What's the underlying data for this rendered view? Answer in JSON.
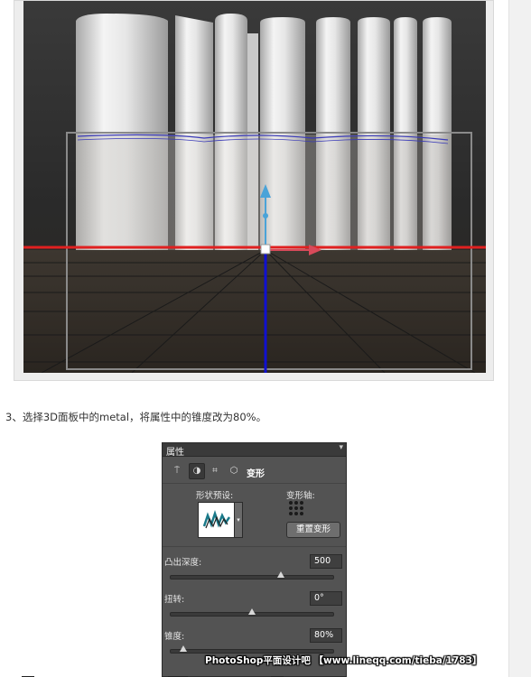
{
  "caption": {
    "text": "3、选择3D面板中的metal，将属性中的锥度改为80%。"
  },
  "panel": {
    "title": "属性",
    "menu_icon": "panel-menu-icon",
    "tools": [
      "mesh-icon",
      "deform-icon",
      "cap-icon",
      "coordinates-icon"
    ],
    "tab_label": "变形",
    "shape_preset_label": "形状预设:",
    "deform_axis_label": "变形轴:",
    "reset_button": "重置变形",
    "extrusion_depth_label": "凸出深度:",
    "extrusion_depth_value": "500",
    "twist_label": "扭转:",
    "twist_value": "0°",
    "taper_label": "锥度:",
    "taper_value": "80%",
    "extrusion_slider_fraction": 0.68,
    "twist_slider_fraction": 0.5,
    "taper_slider_fraction": 0.08
  },
  "watermark": {
    "text": "PhotoShop平面设计吧 【www.lineqq.com/tieba/1783】"
  },
  "colors": {
    "panel_bg": "#535353",
    "axis_red": "#e02020",
    "axis_blue": "#1010d0",
    "gizmo": "#4aa3d8"
  }
}
